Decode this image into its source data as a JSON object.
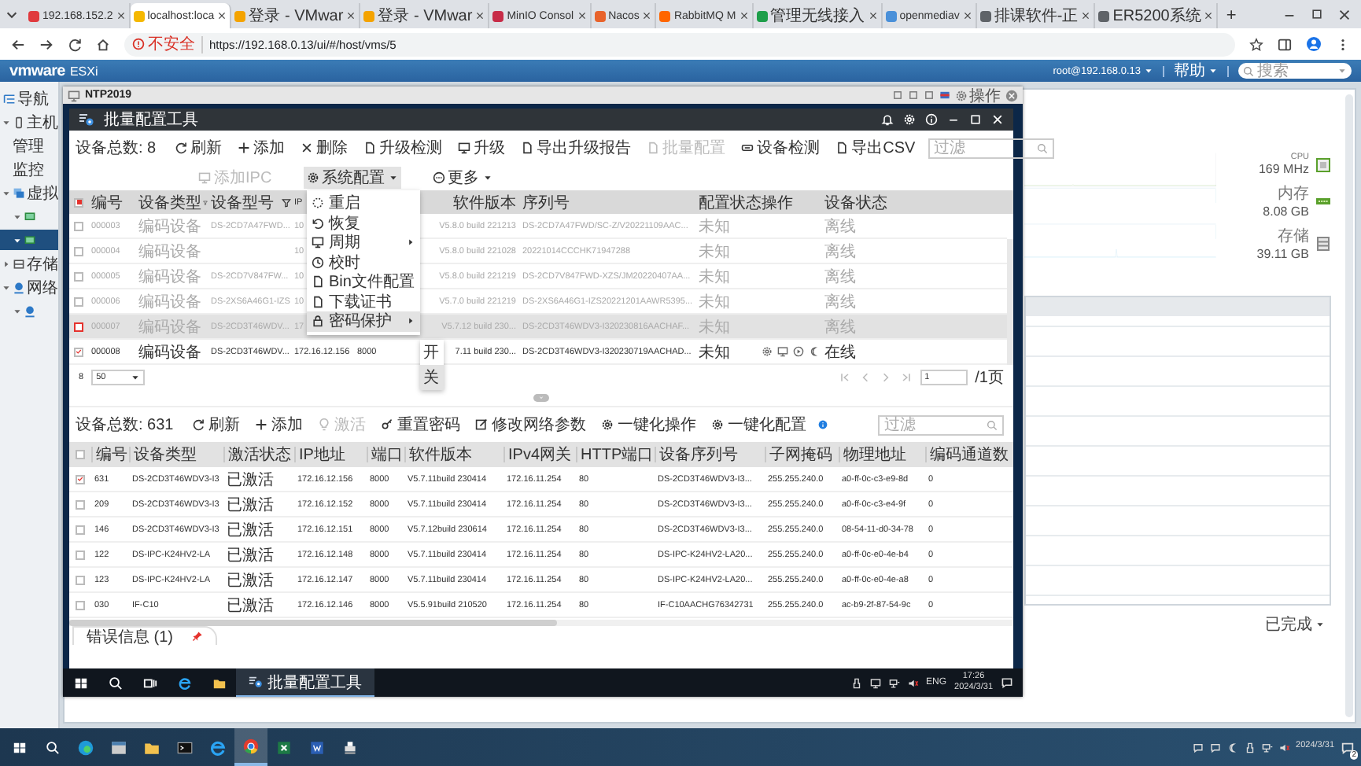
{
  "browser": {
    "tabs": [
      {
        "title": "192.168.152.2",
        "selected": false,
        "color": "#e03a3e"
      },
      {
        "title": "localhost:loca",
        "selected": true,
        "color": "#f5b800"
      },
      {
        "title": "登录 - VMwar",
        "selected": false,
        "color": "#f4a300"
      },
      {
        "title": "登录 - VMwar",
        "selected": false,
        "color": "#f4a300"
      },
      {
        "title": "MinIO Consol",
        "selected": false,
        "color": "#c72c48"
      },
      {
        "title": "Nacos",
        "selected": false,
        "color": "#e8632b"
      },
      {
        "title": "RabbitMQ M",
        "selected": false,
        "color": "#ff6600"
      },
      {
        "title": "管理无线接入",
        "selected": false,
        "color": "#1e9e4a"
      },
      {
        "title": "openmediav",
        "selected": false,
        "color": "#4a90d9"
      },
      {
        "title": "排课软件-正",
        "selected": false,
        "color": "#5f6368"
      },
      {
        "title": "ER5200系统",
        "selected": false,
        "color": "#5f6368"
      }
    ],
    "new_tab": "+",
    "security": "不安全",
    "url": "https://192.168.0.13/ui/#/host/vms/5"
  },
  "esxi": {
    "brand": "vmware",
    "product": "ESXi",
    "user": "root@192.168.0.13",
    "help": "帮助",
    "search": {
      "placeholder": "搜索"
    },
    "navigator": {
      "title": "导航",
      "items": [
        {
          "kind": "host",
          "label": "主机",
          "expanded": true,
          "selected": false,
          "children": [
            {
              "kind": "page",
              "label": "管理",
              "selected": false
            },
            {
              "kind": "page",
              "label": "监控",
              "selected": false
            }
          ]
        },
        {
          "kind": "vms",
          "label": "虚拟",
          "expanded": true,
          "selected": false,
          "children": [
            {
              "kind": "vm",
              "expanded": true,
              "selected": false
            },
            {
              "kind": "vm",
              "expanded": true,
              "selected": true
            }
          ]
        },
        {
          "kind": "storage",
          "label": "存储",
          "expanded": false,
          "selected": false
        },
        {
          "kind": "network",
          "label": "网络",
          "expanded": true,
          "selected": false,
          "children": [
            {
              "kind": "net",
              "expanded": true,
              "selected": false
            }
          ]
        }
      ]
    },
    "stats": [
      {
        "kind": "cpu",
        "label": "CPU",
        "value": "169 MHz"
      },
      {
        "kind": "memory",
        "label": "内存",
        "value": "8.08 GB"
      },
      {
        "kind": "storage",
        "label": "存储",
        "value": "39.11 GB"
      }
    ],
    "tasks_filter": "已完成"
  },
  "console": {
    "title": "NTP2019",
    "action": "操作"
  },
  "tool": {
    "title": "批量配置工具",
    "devices": {
      "count": "设备总数: 8",
      "actions": [
        {
          "kind": "refresh",
          "label": "刷新",
          "disabled": false
        },
        {
          "kind": "add",
          "label": "添加",
          "disabled": false
        },
        {
          "kind": "delete",
          "label": "删除",
          "disabled": false
        },
        {
          "kind": "check",
          "label": "升级检测",
          "disabled": false
        },
        {
          "kind": "upgrade",
          "label": "升级",
          "disabled": false
        },
        {
          "kind": "report",
          "label": "导出升级报告",
          "disabled": false
        },
        {
          "kind": "batch",
          "label": "批量配置",
          "disabled": true
        },
        {
          "kind": "detect",
          "label": "设备检测",
          "disabled": false
        },
        {
          "kind": "export",
          "label": "导出CSV",
          "disabled": false
        }
      ],
      "filter": {
        "placeholder": "过滤"
      },
      "actions2": [
        {
          "kind": "add-ipc",
          "label": "添加IPC",
          "disabled": true,
          "dropdown": false,
          "expanded": false
        },
        {
          "kind": "settings",
          "label": "系统配置",
          "disabled": false,
          "dropdown": true,
          "expanded": true
        },
        {
          "kind": "more",
          "label": "更多",
          "disabled": false,
          "dropdown": true,
          "expanded": false
        }
      ],
      "select_all_partial": true,
      "columns": [
        "编号",
        "设备类型",
        "设备型号",
        "IP",
        "软件版本",
        "序列号",
        "配置状态",
        "操作",
        "设备状态"
      ],
      "rows": [
        {
          "id": "000003",
          "type": "编码设备",
          "model": "DS-2CD7A47FWD...",
          "ip": "10",
          "version": "V5.8.0 build 221213",
          "serial": "DS-2CD7A47FWD/SC-Z/V20221109AAC...",
          "config": "未知",
          "status": "离线",
          "online": false,
          "checked": false,
          "selected": false
        },
        {
          "id": "000004",
          "type": "编码设备",
          "ip": "10",
          "version": "V5.8.0 build 221028",
          "serial": "20221014CCCHK71947288",
          "config": "未知",
          "status": "离线",
          "online": false,
          "checked": false,
          "selected": false
        },
        {
          "id": "000005",
          "type": "编码设备",
          "model": "DS-2CD7V847FW...",
          "ip": "10",
          "version": "V5.8.0 build 221219",
          "serial": "DS-2CD7V847FWD-XZS/JM20220407AA...",
          "config": "未知",
          "status": "离线",
          "online": false,
          "checked": false,
          "selected": false
        },
        {
          "id": "000006",
          "type": "编码设备",
          "model": "DS-2XS6A46G1-IZS",
          "ip": "10",
          "version": "V5.7.0 build 221219",
          "serial": "DS-2XS6A46G1-IZS20221201AAWR5395...",
          "config": "未知",
          "status": "离线",
          "online": false,
          "checked": false,
          "selected": false
        },
        {
          "id": "000007",
          "type": "编码设备",
          "model": "DS-2CD3T46WDV...",
          "ip": "17",
          "version": "V5.7.12 build 230...",
          "serial": "DS-2CD3T46WDV3-I320230816AACHAF...",
          "config": "未知",
          "status": "离线",
          "online": false,
          "checked": false,
          "selected": true
        },
        {
          "id": "000008",
          "type": "编码设备",
          "model": "DS-2CD3T46WDV...",
          "ip": "172.16.12.156",
          "port": "8000",
          "version": "7.11 build 230...",
          "serial": "DS-2CD3T46WDV3-I320230719AACHAD...",
          "config": "未知",
          "status": "在线",
          "online": true,
          "checked": true,
          "selected": false
        }
      ],
      "menu": [
        {
          "kind": "restart",
          "label": "重启",
          "submenu": false,
          "selected": false
        },
        {
          "kind": "restore",
          "label": "恢复",
          "submenu": false,
          "selected": false
        },
        {
          "kind": "display",
          "label": "周期",
          "submenu": true,
          "selected": false
        },
        {
          "kind": "time",
          "label": "校时",
          "submenu": false,
          "selected": false
        },
        {
          "kind": "file",
          "label": "Bin文件配置",
          "submenu": false,
          "selected": false
        },
        {
          "kind": "cert",
          "label": "下载证书",
          "submenu": false,
          "selected": false
        },
        {
          "kind": "lock",
          "label": "密码保护",
          "submenu": true,
          "selected": true
        }
      ],
      "submenu": [
        {
          "label": "开",
          "selected": false
        },
        {
          "label": "关",
          "selected": true
        }
      ],
      "pagination": {
        "total": "8",
        "page_size": "50",
        "page": "1",
        "pages": "/1页"
      }
    },
    "discovered": {
      "count": "设备总数: 631",
      "actions": [
        {
          "kind": "refresh",
          "label": "刷新",
          "disabled": false
        },
        {
          "kind": "add",
          "label": "添加",
          "disabled": false
        },
        {
          "kind": "activate",
          "label": "激活",
          "disabled": true
        },
        {
          "kind": "reset",
          "label": "重置密码",
          "disabled": false
        },
        {
          "kind": "network",
          "label": "修改网络参数",
          "disabled": false
        },
        {
          "kind": "operate",
          "label": "一键化操作",
          "disabled": false
        },
        {
          "kind": "configure",
          "label": "一键化配置",
          "disabled": false
        }
      ],
      "filter": {
        "placeholder": "过滤"
      },
      "select_all_checked": false,
      "columns": [
        "编号",
        "设备类型",
        "激活状态",
        "IP地址",
        "端口",
        "软件版本",
        "IPv4网关",
        "HTTP端口",
        "设备序列号",
        "子网掩码",
        "物理地址",
        "编码通道数"
      ],
      "rows": [
        {
          "checked": true,
          "cells": [
            "631",
            "DS-2CD3T46WDV3-I3",
            "已激活",
            "172.16.12.156",
            "8000",
            "V5.7.11build 230414",
            "172.16.11.254",
            "80",
            "DS-2CD3T46WDV3-I3...",
            "255.255.240.0",
            "a0-ff-0c-c3-e9-8d",
            "0"
          ]
        },
        {
          "checked": false,
          "cells": [
            "209",
            "DS-2CD3T46WDV3-I3",
            "已激活",
            "172.16.12.152",
            "8000",
            "V5.7.11build 230414",
            "172.16.11.254",
            "80",
            "DS-2CD3T46WDV3-I3...",
            "255.255.240.0",
            "a0-ff-0c-c3-e4-9f",
            "0"
          ]
        },
        {
          "checked": false,
          "cells": [
            "146",
            "DS-2CD3T46WDV3-I3",
            "已激活",
            "172.16.12.151",
            "8000",
            "V5.7.12build 230614",
            "172.16.11.254",
            "80",
            "DS-2CD3T46WDV3-I3...",
            "255.255.240.0",
            "08-54-11-d0-34-78",
            "0"
          ]
        },
        {
          "checked": false,
          "cells": [
            "122",
            "DS-IPC-K24HV2-LA",
            "已激活",
            "172.16.12.148",
            "8000",
            "V5.7.11build 230414",
            "172.16.11.254",
            "80",
            "DS-IPC-K24HV2-LA20...",
            "255.255.240.0",
            "a0-ff-0c-e0-4e-b4",
            "0"
          ]
        },
        {
          "checked": false,
          "cells": [
            "123",
            "DS-IPC-K24HV2-LA",
            "已激活",
            "172.16.12.147",
            "8000",
            "V5.7.11build 230414",
            "172.16.11.254",
            "80",
            "DS-IPC-K24HV2-LA20...",
            "255.255.240.0",
            "a0-ff-0c-e0-4e-a8",
            "0"
          ]
        },
        {
          "checked": false,
          "cells": [
            "030",
            "IF-C10",
            "已激活",
            "172.16.12.146",
            "8000",
            "V5.5.91build 210520",
            "172.16.11.254",
            "80",
            "IF-C10AACHG76342731",
            "255.255.240.0",
            "ac-b9-2f-87-54-9c",
            "0"
          ]
        }
      ]
    },
    "error_tab": "错误信息 (1)"
  },
  "guest_taskbar": {
    "task": "批量配置工具",
    "language": "ENG",
    "time": "17:26",
    "date": "2024/3/31"
  },
  "host_taskbar": {
    "date": "2024/3/31",
    "notifications": "2"
  }
}
